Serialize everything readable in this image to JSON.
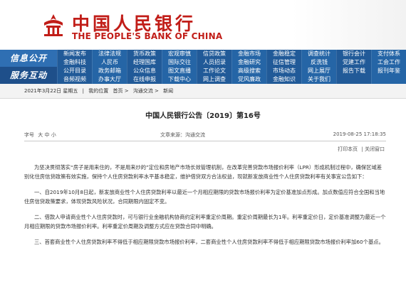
{
  "header": {
    "cn_name": "中国人民银行",
    "en_name": "THE PEOPLE'S BANK OF CHINA",
    "brand_color": "#c11d18"
  },
  "nav": {
    "row1_label": "信息公开",
    "row2_label": "服务互动",
    "cells": [
      [
        "新闻发布",
        "法律法规",
        "货币政策",
        "宏观审慎",
        "信贷政策",
        "金融市场",
        "金融稳定",
        "调查统计",
        "银行会计",
        "支付体系"
      ],
      [
        "金融科技",
        "人民币",
        "经理国库",
        "国际交往",
        "人员招录",
        "金融研究",
        "征信管理",
        "反洗钱",
        "党建工作",
        "工会工作"
      ],
      [
        "公开目录",
        "政务邮箱",
        "公众信息",
        "图文直播",
        "工作论文",
        "高级搜索",
        "市场动态",
        "网上展厅",
        "报告下载",
        "报刊年鉴"
      ],
      [
        "音频视频",
        "办事大厅",
        "在线申报",
        "下载中心",
        "网上调查",
        "党风廉政",
        "金融知识",
        "关于我们",
        "",
        ""
      ]
    ],
    "bg_color": "#215a98"
  },
  "breadcrumb": {
    "date": "2021年3月22日 星期五",
    "location_label": "我的位置",
    "items": [
      "首页",
      "沟通交流",
      "新闻"
    ]
  },
  "article": {
    "title": "中国人民银行公告〔2019〕第16号",
    "meta_source_label": "字号",
    "meta_sizes": [
      "大",
      "中",
      "小"
    ],
    "meta_source": "文章来源：沟通交流",
    "meta_time": "2019-08-25 17:18:35",
    "print_label": "打印本页",
    "close_label": "关闭窗口",
    "paragraphs": [
      "为坚决贯彻落实“房子是用来住的，不是用来炒的”定位和房地产市场长效管理机制，在改革完善贷款市场报价利率（LPR）形成机制过程中，确保区域差别化住房信贷政策有效实施，保持个人住房贷款利率水平基本稳定，维护借贷双方合法权益，现就新发放商业性个人住房贷款利率有关事宜公告如下：",
      "一、自2019年10月8日起，新发放商业性个人住房贷款利率以最近一个月相应期限的贷款市场报价利率为定价基准加点形成。加点数值应符合全国和当地住房信贷政策要求，体现贷款风险状况，合同期限内固定不变。",
      "二、借款人申请商业性个人住房贷款时，可与银行业金融机构协商约定利率重定价周期。重定价周期最长为1年。利率重定价日，定价基准调整为最近一个月相应期限的贷款市场报价利率。利率重定价周期及调整方式应在贷款合同中明确。",
      "三、首套商业性个人住房贷款利率不得低于相应期限贷款市场报价利率，二套商业性个人住房贷款利率不得低于相应期限贷款市场报价利率加60个基点。"
    ]
  }
}
